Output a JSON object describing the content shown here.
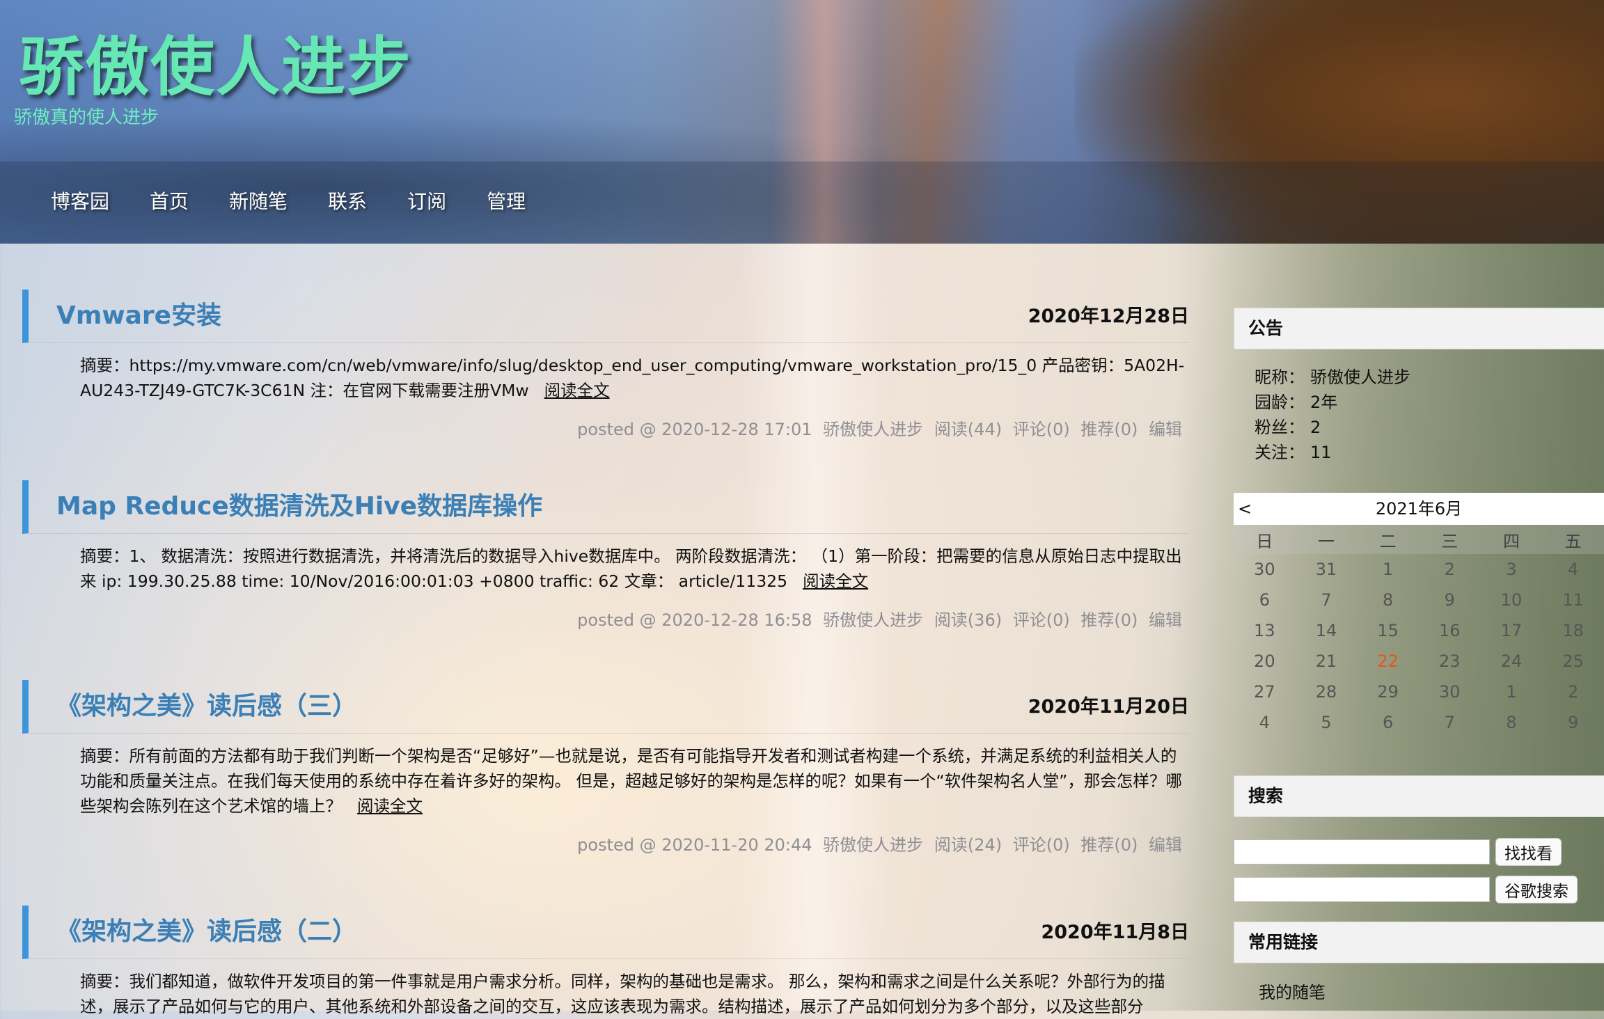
{
  "header": {
    "title": "骄傲使人进步",
    "subtitle": "骄傲真的使人进步",
    "nav": [
      "博客园",
      "首页",
      "新随笔",
      "联系",
      "订阅",
      "管理"
    ]
  },
  "posts": [
    {
      "title": "Vmware安装",
      "date": "2020年12月28日",
      "summary": "摘要：https://my.vmware.com/cn/web/vmware/info/slug/desktop_end_user_computing/vmware_workstation_pro/15_0 产品密钥：5A02H-AU243-TZJ49-GTC7K-3C61N 注：在官网下载需要注册VMw",
      "read_more": "阅读全文",
      "posted": "posted @ 2020-12-28 17:01",
      "author": "骄傲使人进步",
      "reads": "阅读(44)",
      "comments": "评论(0)",
      "recommends": "推荐(0)",
      "edit": "编辑"
    },
    {
      "title": "Map Reduce数据清洗及Hive数据库操作",
      "date": "",
      "summary": "摘要：1、 数据清洗：按照进行数据清洗，并将清洗后的数据导入hive数据库中。 两阶段数据清洗： （1）第一阶段：把需要的信息从原始日志中提取出来 ip: 199.30.25.88 time: 10/Nov/2016:00:01:03 +0800 traffic: 62 文章： article/11325",
      "read_more": "阅读全文",
      "posted": "posted @ 2020-12-28 16:58",
      "author": "骄傲使人进步",
      "reads": "阅读(36)",
      "comments": "评论(0)",
      "recommends": "推荐(0)",
      "edit": "编辑"
    },
    {
      "title": "《架构之美》读后感（三）",
      "date": "2020年11月20日",
      "summary": "摘要：所有前面的方法都有助于我们判断一个架构是否“足够好”—也就是说，是否有可能指导开发者和测试者构建一个系统，并满足系统的利益相关人的功能和质量关注点。在我们每天使用的系统中存在着许多好的架构。 但是，超越足够好的架构是怎样的呢？如果有一个“软件架构名人堂”，那会怎样？哪些架构会陈列在这个艺术馆的墙上？",
      "read_more": "阅读全文",
      "posted": "posted @ 2020-11-20 20:44",
      "author": "骄傲使人进步",
      "reads": "阅读(24)",
      "comments": "评论(0)",
      "recommends": "推荐(0)",
      "edit": "编辑"
    },
    {
      "title": "《架构之美》读后感（二）",
      "date": "2020年11月8日",
      "summary": "摘要：我们都知道，做软件开发项目的第一件事就是用户需求分析。同样，架构的基础也是需求。 那么，架构和需求之间是什么关系呢？外部行为的描述，展示了产品如何与它的用户、其他系统和外部设备之间的交互，这应该表现为需求。结构描述，展示了产品如何划分为多个部分，以及这些部分"
    }
  ],
  "sidebar": {
    "notice_title": "公告",
    "profile": [
      {
        "label": "昵称：",
        "value": "骄傲使人进步"
      },
      {
        "label": "园龄：",
        "value": "2年"
      },
      {
        "label": "粉丝：",
        "value": "2"
      },
      {
        "label": "关注：",
        "value": "11"
      }
    ],
    "calendar": {
      "prev": "<",
      "month": "2021年6月",
      "weekdays": [
        "日",
        "一",
        "二",
        "三",
        "四",
        "五"
      ],
      "weeks": [
        [
          "30",
          "31",
          "1",
          "2",
          "3",
          "4"
        ],
        [
          "6",
          "7",
          "8",
          "9",
          "10",
          "11"
        ],
        [
          "13",
          "14",
          "15",
          "16",
          "17",
          "18"
        ],
        [
          "20",
          "21",
          "22",
          "23",
          "24",
          "25"
        ],
        [
          "27",
          "28",
          "29",
          "30",
          "1",
          "2"
        ],
        [
          "4",
          "5",
          "6",
          "7",
          "8",
          "9"
        ]
      ],
      "today": "22",
      "today_color": "#e2571e"
    },
    "search_title": "搜索",
    "search_button": "找找看",
    "google_button": "谷歌搜索",
    "links_title": "常用链接",
    "links": [
      "我的随笔"
    ]
  },
  "colors": {
    "title": "#66e8b4",
    "post_title": "#3a7fb6",
    "post_bar": "#3d94d8",
    "meta": "#8f8f94"
  }
}
